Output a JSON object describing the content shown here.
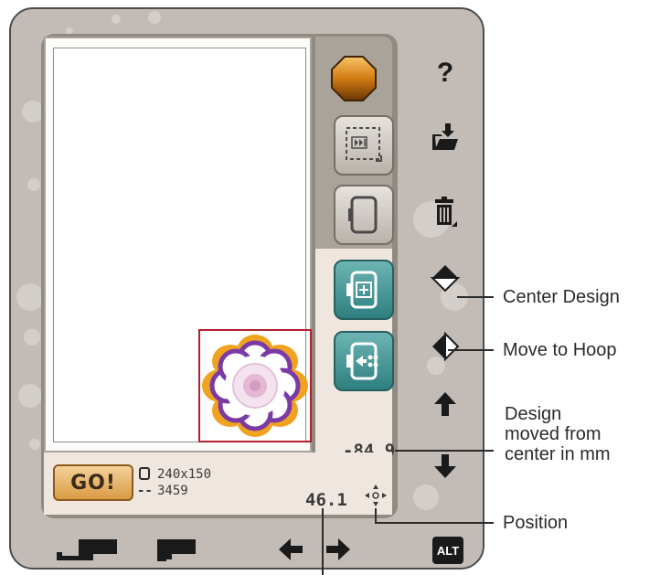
{
  "toolbar": {
    "help_label": "?",
    "go_label": "GO!",
    "alt_label": "ALT"
  },
  "design_info": {
    "hoop_size": "240x150",
    "stitch_count": "3459",
    "x_offset": "46.1",
    "y_offset": "-84.9"
  },
  "callouts": {
    "center_design": "Center Design",
    "move_to_hoop": "Move to Hoop",
    "design_moved_1": "Design",
    "design_moved_2": "moved from",
    "design_moved_3": "center in mm",
    "position": "Position"
  },
  "colors": {
    "accent_teal": "#3f8f90",
    "hoop_outline": "#b2202d",
    "flower_purple": "#7b3aa5",
    "flower_orange": "#f0a320",
    "device_bg": "#c3bcb6"
  },
  "icons": {
    "help": "help-icon",
    "open": "open-folder-icon",
    "delete": "trash-icon",
    "mirror_h": "mirror-horizontal-icon",
    "mirror_v": "mirror-vertical-icon",
    "up": "arrow-up-icon",
    "down": "arrow-down-icon",
    "left": "arrow-left-icon",
    "right": "arrow-right-icon",
    "position": "move-position-icon"
  }
}
